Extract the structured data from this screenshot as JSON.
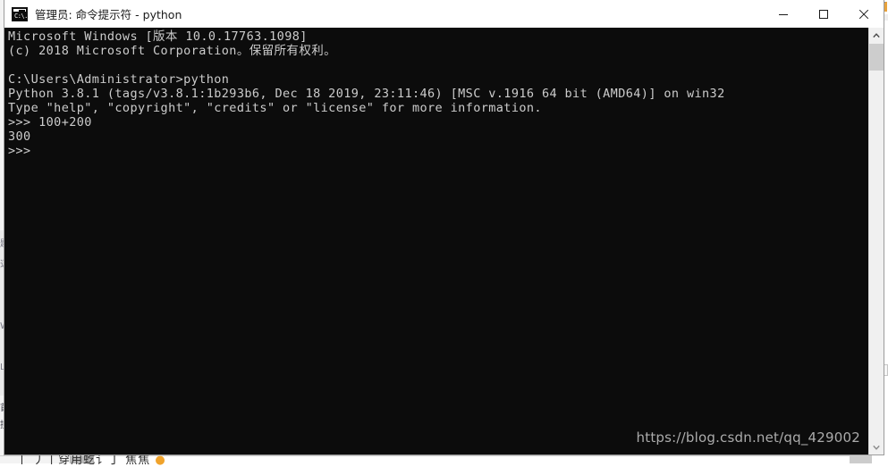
{
  "window": {
    "title": "管理员: 命令提示符 - python",
    "icon": "cmd-icon",
    "icon_glyph": "C:\\.",
    "controls": {
      "minimize_label": "最小化",
      "maximize_label": "最大化",
      "close_label": "关闭"
    }
  },
  "console": {
    "background_color": "#0c0c0c",
    "text_color": "#cccccc",
    "lines": [
      "Microsoft Windows [版本 10.0.17763.1098]",
      "(c) 2018 Microsoft Corporation。保留所有权利。",
      "",
      "C:\\Users\\Administrator>python",
      "Python 3.8.1 (tags/v3.8.1:1b293b6, Dec 18 2019, 23:11:46) [MSC v.1916 64 bit (AMD64)] on win32",
      "Type \"help\", \"copyright\", \"credits\" or \"license\" for more information.",
      ">>> 100+200",
      "300",
      ">>>"
    ],
    "text": "Microsoft Windows [版本 10.0.17763.1098]\n(c) 2018 Microsoft Corporation。保留所有权利。\n\nC:\\Users\\Administrator>python\nPython 3.8.1 (tags/v3.8.1:1b293b6, Dec 18 2019, 23:11:46) [MSC v.1916 64 bit (AMD64)] on win32\nType \"help\", \"copyright\", \"credits\" or \"license\" for more information.\n>>> 100+200\n300\n>>>",
    "scrollbar": {
      "up_arrow": "⌃",
      "down_arrow": "⌄"
    }
  },
  "watermark": {
    "text": "https://blog.csdn.net/qq_429002"
  },
  "background": {
    "left_glyphs": "题\n迈\n\n\nW\n\nL",
    "left_glyphs_2": "首\n搜",
    "bottom_caption": "丨 丿丨穿用虼讠丁  焦焦",
    "bottom_caption_emoji": "●",
    "right_tab_glyph": "⌄"
  }
}
